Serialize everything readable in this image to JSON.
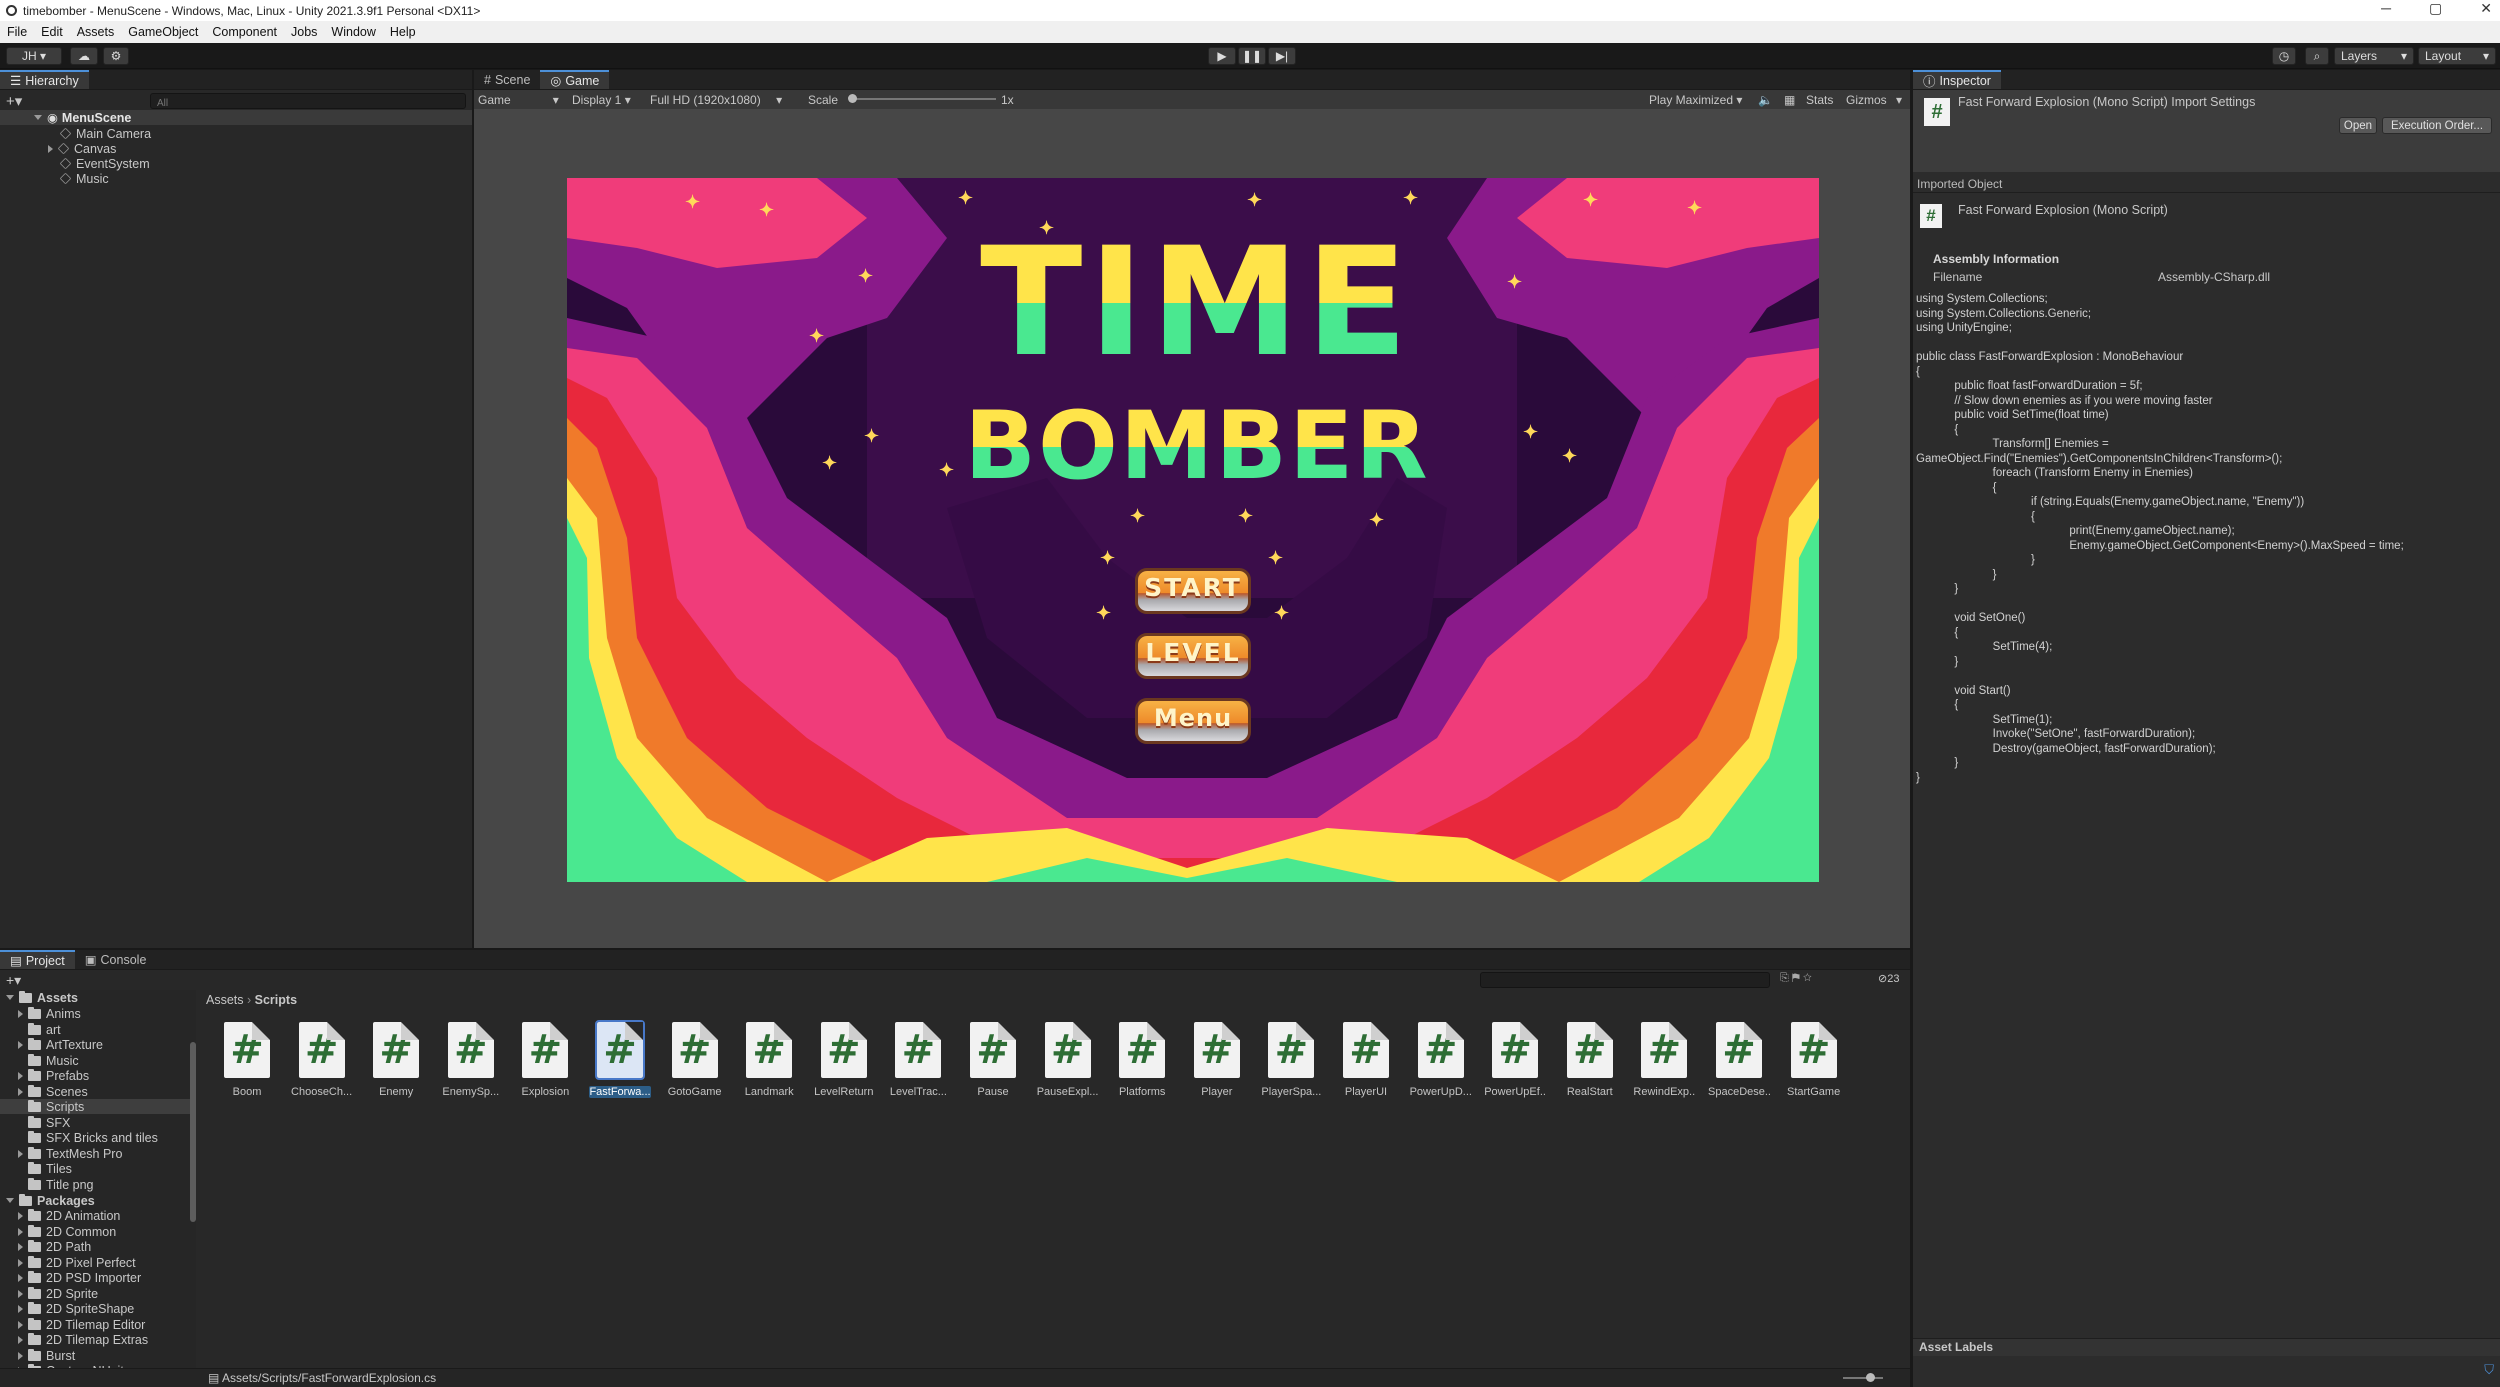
{
  "window": {
    "title": "timebomber - MenuScene - Windows, Mac, Linux - Unity 2021.3.9f1 Personal <DX11>",
    "minimize": "─",
    "maximize": "▢",
    "close": "✕"
  },
  "menu": [
    "File",
    "Edit",
    "Assets",
    "GameObject",
    "Component",
    "Jobs",
    "Window",
    "Help"
  ],
  "toolbar": {
    "account": "JH ▾",
    "layers": "Layers",
    "layout": "Layout"
  },
  "hierarchy": {
    "tab": "Hierarchy",
    "search_placeholder": "All",
    "scene": "MenuScene",
    "items": [
      "Main Camera",
      "Canvas",
      "EventSystem",
      "Music"
    ]
  },
  "center_tabs": {
    "scene": "Scene",
    "game": "Game"
  },
  "game_bar": {
    "mode": "Game",
    "display": "Display 1",
    "resolution": "Full HD (1920x1080)",
    "scale_label": "Scale",
    "scale_value": "1x",
    "play": "Play Maximized",
    "stats": "Stats",
    "gizmos": "Gizmos"
  },
  "game_view": {
    "title_line1": "TIME",
    "title_line2": "BOMBER",
    "buttons": [
      "START",
      "LEVEL",
      "Menu"
    ],
    "colors": {
      "sky": "#2a0a3a",
      "pink": "#f03c7a",
      "yellow": "#ffe44a",
      "green": "#4ae890",
      "orange": "#f07a2a",
      "purple": "#8a1a8a"
    }
  },
  "inspector": {
    "tab": "Inspector",
    "header_title": "Fast Forward Explosion (Mono Script) Import Settings",
    "open_btn": "Open",
    "exec_btn": "Execution Order...",
    "imported_object": "Imported Object",
    "object_title": "Fast Forward Explosion (Mono Script)",
    "assembly_info": "Assembly Information",
    "filename_label": "Filename",
    "filename_value": "Assembly-CSharp.dll",
    "code": "using System.Collections;\nusing System.Collections.Generic;\nusing UnityEngine;\n\npublic class FastForwardExplosion : MonoBehaviour\n{\n            public float fastForwardDuration = 5f;\n            // Slow down enemies as if you were moving faster\n            public void SetTime(float time)\n            {\n                        Transform[] Enemies =\nGameObject.Find(\"Enemies\").GetComponentsInChildren<Transform>();\n                        foreach (Transform Enemy in Enemies)\n                        {\n                                    if (string.Equals(Enemy.gameObject.name, \"Enemy\"))\n                                    {\n                                                print(Enemy.gameObject.name);\n                                                Enemy.gameObject.GetComponent<Enemy>().MaxSpeed = time;\n                                    }\n                        }\n            }\n\n            void SetOne()\n            {\n                        SetTime(4);\n            }\n\n            void Start()\n            {\n                        SetTime(1);\n                        Invoke(\"SetOne\", fastForwardDuration);\n                        Destroy(gameObject, fastForwardDuration);\n            }\n}",
    "asset_labels": "Asset Labels"
  },
  "project": {
    "tab": "Project",
    "console_tab": "Console",
    "count": "23",
    "breadcrumb": [
      "Assets",
      "Scripts"
    ],
    "tree_assets_root": "Assets",
    "tree_assets": [
      "Anims",
      "art",
      "ArtTexture",
      "Music",
      "Prefabs",
      "Scenes",
      "Scripts",
      "SFX",
      "SFX Bricks and tiles",
      "TextMesh Pro",
      "Tiles",
      "Title png"
    ],
    "tree_packages_root": "Packages",
    "tree_packages": [
      "2D Animation",
      "2D Common",
      "2D Path",
      "2D Pixel Perfect",
      "2D PSD Importer",
      "2D Sprite",
      "2D SpriteShape",
      "2D Tilemap Editor",
      "2D Tilemap Extras",
      "Burst",
      "Custom NUnit"
    ],
    "scripts": [
      "Boom",
      "ChooseCh...",
      "Enemy",
      "EnemySp...",
      "Explosion",
      "FastForwa...",
      "GotoGame",
      "Landmark",
      "LevelReturn",
      "LevelTrac...",
      "Pause",
      "PauseExpl...",
      "Platforms",
      "Player",
      "PlayerSpa...",
      "PlayerUI",
      "PowerUpD...",
      "PowerUpEf...",
      "RealStart",
      "RewindExp...",
      "SpaceDese...",
      "StartGame"
    ],
    "selected_index": 5,
    "status_path": "Assets/Scripts/FastForwardExplosion.cs"
  }
}
